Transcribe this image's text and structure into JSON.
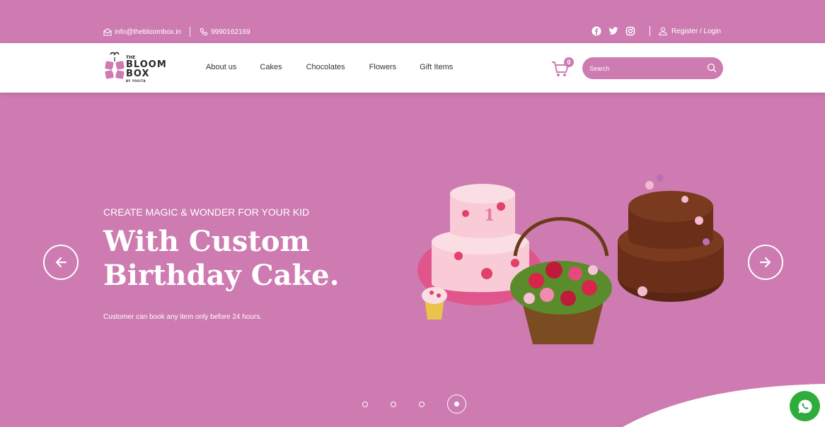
{
  "topbar": {
    "email": "info@thebloombox.in",
    "phone": "9990162169",
    "login": "Register / Login"
  },
  "logo": {
    "line1": "THE",
    "line2": "BLOOM",
    "line3": "BOX",
    "line4": "BY YOGITA"
  },
  "nav": {
    "items": [
      "About us",
      "Cakes",
      "Chocolates",
      "Flowers",
      "Gift Items"
    ]
  },
  "cart": {
    "count": "0"
  },
  "search": {
    "placeholder": "Search"
  },
  "hero": {
    "subtitle": "CREATE MAGIC & WONDER FOR YOUR KID",
    "title": "With Custom Birthday Cake.",
    "note": "Customer can book any item only before 24 hours."
  },
  "carousel": {
    "slides": 4,
    "active_index": 3
  },
  "colors": {
    "brand": "#cd7bb1",
    "whatsapp": "#2fad3c"
  },
  "icons": [
    "email-icon",
    "phone-icon",
    "facebook-icon",
    "twitter-icon",
    "instagram-icon",
    "user-icon",
    "cart-icon",
    "search-icon",
    "arrow-left-icon",
    "arrow-right-icon",
    "whatsapp-icon"
  ]
}
